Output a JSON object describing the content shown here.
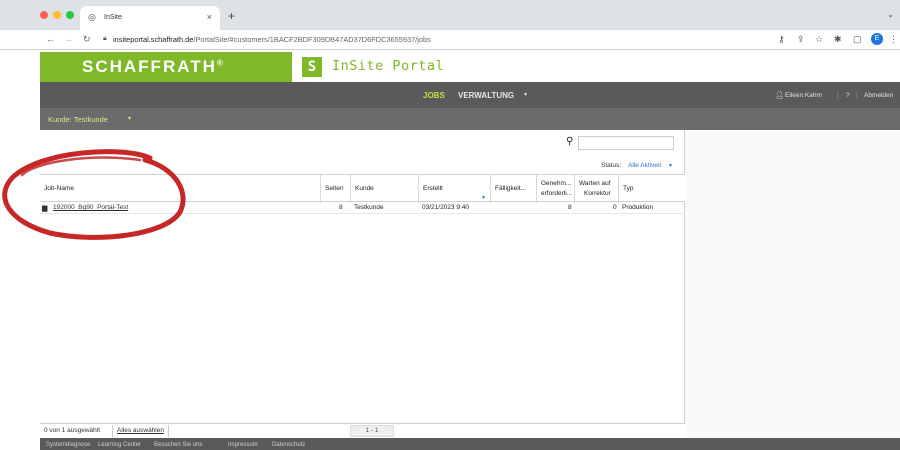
{
  "browser": {
    "tab_title": "InSite",
    "tab_close": "×",
    "new_tab": "+",
    "url_domain": "insiteportal.schaffrath.de",
    "url_path": "/PortalSite/#customers/1BACF2BDF309DB47AD37D6FDC3655937/jobs",
    "profile_initial": "E"
  },
  "brand": {
    "name": "SCHAFFRATH",
    "mark": "®",
    "portal_letter": "S",
    "portal_title": "InSite Portal",
    "green": "#7fb829"
  },
  "nav": {
    "jobs": "JOBS",
    "verwaltung": "VERWALTUNG",
    "user": "Eileen Kahm",
    "help": "?",
    "logout": "Abmelden"
  },
  "customer": {
    "label": "Kunde: Testkunde"
  },
  "toolbar": {
    "status_label": "Status:",
    "status_value": "Alle Aktiven"
  },
  "table": {
    "headers": {
      "job_name": "Job-Name",
      "pages": "Seiten",
      "customer": "Kunde",
      "created": "Erstellt",
      "due": "Fälligkeit...",
      "approval_1": "Genehm...",
      "approval_2": "erforderli...",
      "wait_1": "Warten auf",
      "wait_2": "Korrektur",
      "type": "Typ"
    },
    "rows": [
      {
        "job_name": "192000_Bg90_Portal-Test",
        "pages": "8",
        "customer": "Testkunde",
        "created": "03/21/2023 9:40",
        "due": "",
        "approval": "8",
        "waiting": "0",
        "type": "Produktion"
      }
    ]
  },
  "pager": {
    "selected": "0 von 1 ausgewählt",
    "select_all": "Alles auswählen",
    "range": "1 - 1"
  },
  "footer": {
    "items": [
      "Systemdiagnose",
      "Learning Center",
      "Besuchen Sie uns",
      "Impressum",
      "Datenschutz"
    ]
  },
  "colors": {
    "nav_bg": "#5a5a5a",
    "active_nav": "#c7dd3c",
    "link_blue": "#2f6fd0",
    "annotation_red": "#c62828"
  }
}
